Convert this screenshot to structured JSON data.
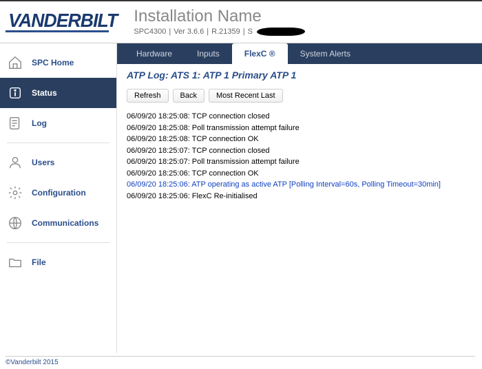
{
  "header": {
    "logo_text": "VANDERBILT",
    "install_name": "Installation Name",
    "device_model": "SPC4300",
    "version": "Ver 3.6.6",
    "revision": "R.21359",
    "serial_prefix": "S"
  },
  "sidebar": {
    "items": [
      {
        "label": "SPC Home",
        "icon": "home-icon"
      },
      {
        "label": "Status",
        "icon": "info-icon"
      },
      {
        "label": "Log",
        "icon": "log-icon"
      },
      {
        "label": "Users",
        "icon": "users-icon"
      },
      {
        "label": "Configuration",
        "icon": "gear-icon"
      },
      {
        "label": "Communications",
        "icon": "globe-icon"
      },
      {
        "label": "File",
        "icon": "folder-icon"
      }
    ],
    "active_index": 1
  },
  "tabs": {
    "items": [
      {
        "label": "Hardware"
      },
      {
        "label": "Inputs"
      },
      {
        "label": "FlexC ®"
      },
      {
        "label": "System Alerts"
      }
    ],
    "active_index": 2
  },
  "page": {
    "title": "ATP Log: ATS 1: ATP 1 Primary ATP 1",
    "buttons": {
      "refresh": "Refresh",
      "back": "Back",
      "most_recent_last": "Most Recent Last"
    }
  },
  "log": [
    {
      "ts": "06/09/20 18:25:08",
      "msg": "TCP connection closed",
      "hl": false
    },
    {
      "ts": "06/09/20 18:25:08",
      "msg": "Poll transmission attempt failure",
      "hl": false
    },
    {
      "ts": "06/09/20 18:25:08",
      "msg": "TCP connection OK",
      "hl": false
    },
    {
      "ts": "06/09/20 18:25:07",
      "msg": "TCP connection closed",
      "hl": false
    },
    {
      "ts": "06/09/20 18:25:07",
      "msg": "Poll transmission attempt failure",
      "hl": false
    },
    {
      "ts": "06/09/20 18:25:06",
      "msg": "TCP connection OK",
      "hl": false
    },
    {
      "ts": "06/09/20 18:25:06",
      "msg": "ATP operating as active ATP [Polling Interval=60s, Polling Timeout=30min]",
      "hl": true
    },
    {
      "ts": "06/09/20 18:25:06",
      "msg": "FlexC Re-initialised",
      "hl": false
    }
  ],
  "footer": "©Vanderbilt 2015"
}
